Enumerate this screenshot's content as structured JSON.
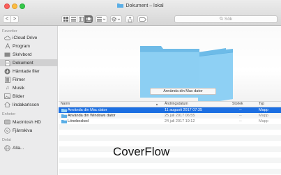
{
  "window": {
    "title": "Dokument – lokal"
  },
  "toolbar": {
    "back_label": "<",
    "forward_label": ">",
    "search_placeholder": "Sök"
  },
  "sidebar": {
    "favorites_header": "Favoriter",
    "favorites": [
      {
        "label": "iCloud Drive",
        "icon": "cloud-icon"
      },
      {
        "label": "Program",
        "icon": "applications-icon"
      },
      {
        "label": "Skrivbord",
        "icon": "desktop-icon"
      },
      {
        "label": "Dokument",
        "icon": "documents-icon",
        "selected": true
      },
      {
        "label": "Hämtade filer",
        "icon": "download-icon"
      },
      {
        "label": "Filmer",
        "icon": "movies-icon"
      },
      {
        "label": "Musik",
        "icon": "music-icon"
      },
      {
        "label": "Bilder",
        "icon": "pictures-icon"
      },
      {
        "label": "lindakarlsson",
        "icon": "home-icon"
      }
    ],
    "devices_header": "Enheter",
    "devices": [
      {
        "label": "Macintosh HD",
        "icon": "hard-drive-icon"
      },
      {
        "label": "Fjärrskiva",
        "icon": "disc-icon"
      }
    ],
    "shared_header": "Delat",
    "shared": [
      {
        "label": "Alla...",
        "icon": "network-icon"
      }
    ]
  },
  "preview": {
    "caption": "Använda din Mac dator"
  },
  "columns": {
    "name": "Namn",
    "date": "Ändringsdatum",
    "size": "Storlek",
    "type": "Typ"
  },
  "files": [
    {
      "name": "Använda din Mac dator",
      "date": "11 augusti 2017 07:35",
      "size": "--",
      "type": "Mapp",
      "selected": true
    },
    {
      "name": "Använda din Windows dator",
      "date": "25 juli 2017 06:55",
      "size": "--",
      "type": "Mapp"
    },
    {
      "name": "Lönebesked",
      "date": "24 juli 2017 19:12",
      "size": "--",
      "type": "Mapp"
    }
  ],
  "view_label": "CoverFlow",
  "colors": {
    "selection": "#1c6fe2",
    "folder": "#7ec8f2"
  }
}
